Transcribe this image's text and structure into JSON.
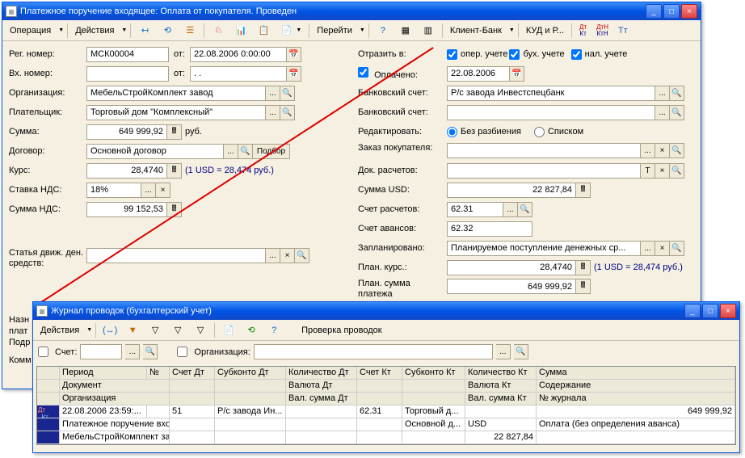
{
  "main": {
    "title": "Платежное поручение входящее: Оплата от покупателя. Проведен",
    "toolbar": {
      "operation": "Операция",
      "actions": "Действия",
      "goto": "Перейти",
      "clientbank": "Клиент-Банк",
      "kudr": "КУД и Р...",
      "dtkt": "ДтКт",
      "dtktH": "ДтН КтН",
      "tt": "Тт"
    },
    "form": {
      "reg_num_label": "Рег. номер:",
      "reg_num": "МСК00004",
      "ot": "от:",
      "reg_date": "22.08.2006 0:00:00",
      "in_num_label": "Вх. номер:",
      "in_num": "",
      "in_date": ". .",
      "org_label": "Организация:",
      "org": "МебельСтройКомплект завод",
      "payer_label": "Плательщик:",
      "payer": "Торговый дом \"Комплексный\"",
      "sum_label": "Сумма:",
      "sum": "649 999,92",
      "rub": "руб.",
      "contract_label": "Договор:",
      "contract": "Основной договор",
      "podbor": "Подбор",
      "rate_label": "Курс:",
      "rate": "28,4740",
      "rate_hint": "(1 USD = 28,474 руб.)",
      "vat_rate_label": "Ставка НДС:",
      "vat_rate": "18%",
      "vat_sum_label": "Сумма НДС:",
      "vat_sum": "99 152,53",
      "cash_flow_label": "Статья движ. ден. средств:",
      "reflect_label": "Отразить в:",
      "oper_uchet": "опер. учете",
      "bukh_uchet": "бух. учете",
      "nal_uchet": "нал. учете",
      "paid_label": "Оплачено:",
      "paid_date": "22.08.2006",
      "bank_acc_label": "Банковский счет:",
      "bank_acc": "Р/с завода Инвестспецбанк",
      "bank_acc2_label": "Банковский счет:",
      "edit_label": "Редактировать:",
      "no_split": "Без разбиения",
      "list": "Списком",
      "order_label": "Заказ покупателя:",
      "doc_calc_label": "Док. расчетов:",
      "sum_usd_label": "Сумма USD:",
      "sum_usd": "22 827,84",
      "acc_calc_label": "Счет расчетов:",
      "acc_calc": "62.31",
      "acc_adv_label": "Счет авансов:",
      "acc_adv": "62.32",
      "planned_label": "Запланировано:",
      "planned": "Планируемое поступление денежных ср...",
      "plan_rate_label": "План. курс.:",
      "plan_rate": "28,4740",
      "plan_rate_hint": "(1 USD = 28,474 руб.)",
      "plan_sum_label": "План. сумма платежа",
      "plan_sum": "649 999,92"
    },
    "bottom": {
      "nazn": "Назн",
      "plate": "плат",
      "podr": "Подр",
      "komm": "Комм"
    }
  },
  "journal": {
    "title": "Журнал проводок (бухгалтерский учет)",
    "toolbar": {
      "actions": "Действия",
      "check": "Проверка проводок"
    },
    "filter": {
      "acc_label": "Счет:",
      "org_label": "Организация:"
    },
    "headers": {
      "period": "Период",
      "num": "№",
      "acc_dt": "Счет Дт",
      "sub_dt": "Субконто Дт",
      "qty_dt": "Количество Дт",
      "acc_kt": "Счет Кт",
      "sub_kt": "Субконто Кт",
      "qty_kt": "Количество Кт",
      "sum": "Сумма",
      "doc": "Документ",
      "cur_dt": "Валюта Дт",
      "cur_kt": "Валюта Кт",
      "content": "Содержание",
      "org": "Организация",
      "valsum_dt": "Вал. сумма Дт",
      "valsum_kt": "Вал. сумма Кт",
      "jrn_num": "№ журнала"
    },
    "row": {
      "period": "22.08.2006 23:59:...",
      "num": "",
      "acc_dt": "51",
      "sub_dt": "Р/с завода Ин...",
      "qty_dt": "",
      "acc_kt": "62.31",
      "sub_kt": "Торговый д...",
      "qty_kt": "",
      "sum": "649 999,92",
      "doc": "Платежное поручение входя...",
      "sub_kt2": "Основной д...",
      "cur_kt": "USD",
      "content": "Оплата (без определения аванса)",
      "org": "МебельСтройКомплект завод",
      "valsum_kt": "22 827,84"
    }
  }
}
